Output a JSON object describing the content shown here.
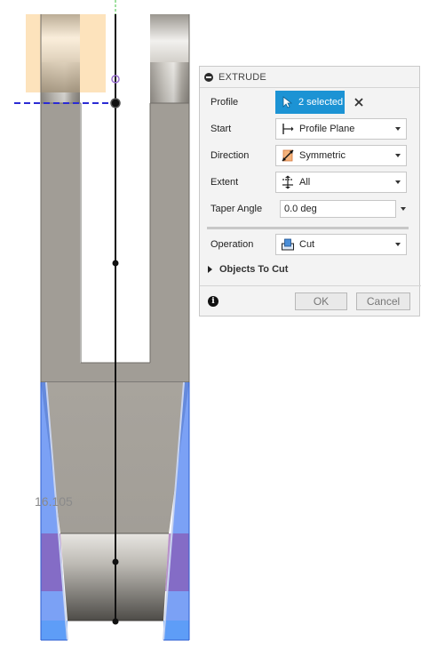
{
  "viewport": {
    "dimension_label": "16.105",
    "colors": {
      "part_gray": "#a19d96",
      "selection_blue": "#4f82f2",
      "plane_orange": "#fcd9a5",
      "sketch_black": "#111111",
      "axis_green": "#40c040",
      "construction_blue": "#2b2bd4",
      "purple_overlap": "#8a4aa6"
    }
  },
  "panel": {
    "title": "EXTRUDE",
    "profile": {
      "label": "Profile",
      "value": "2 selected",
      "icon": "cursor-arrow-icon",
      "clear_icon": "close-x-icon"
    },
    "start": {
      "label": "Start",
      "value": "Profile Plane",
      "icon": "profile-plane-icon"
    },
    "direction": {
      "label": "Direction",
      "value": "Symmetric",
      "icon": "symmetric-direction-icon"
    },
    "extent": {
      "label": "Extent",
      "value": "All",
      "icon": "extent-all-icon"
    },
    "taper_angle": {
      "label": "Taper Angle",
      "value": "0.0 deg"
    },
    "operation": {
      "label": "Operation",
      "value": "Cut",
      "icon": "cut-operation-icon"
    },
    "objects_to_cut": {
      "label": "Objects To Cut"
    },
    "buttons": {
      "ok": "OK",
      "cancel": "Cancel"
    },
    "colors": {
      "accent": "#1c93d4",
      "panel_bg": "#f3f3f3"
    }
  }
}
